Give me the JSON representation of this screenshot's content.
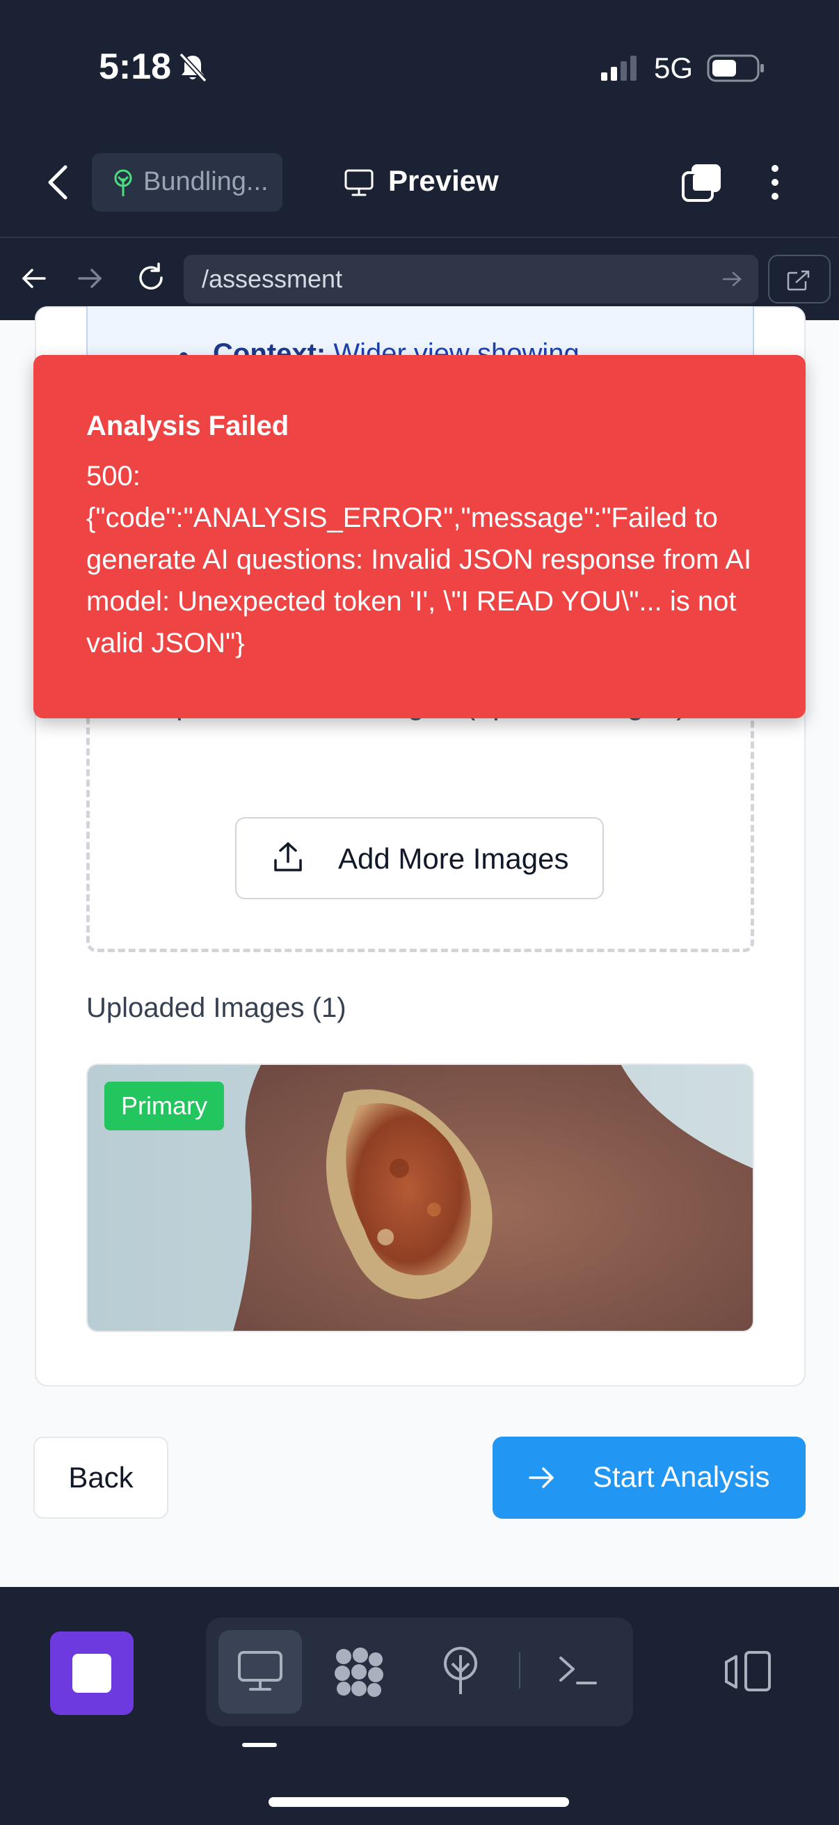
{
  "status_bar": {
    "time": "5:18",
    "network": "5G"
  },
  "app_bar": {
    "bundling_label": "Bundling...",
    "preview_label": "Preview"
  },
  "url_bar": {
    "url": "/assessment"
  },
  "tips": {
    "term": "Context:",
    "text": "Wider view showing"
  },
  "upload": {
    "hint": "Upload wound images (up to 5 images)",
    "add_more_label": "Add More Images",
    "uploaded_heading": "Uploaded Images (1)",
    "primary_badge": "Primary"
  },
  "actions": {
    "back_label": "Back",
    "start_label": "Start Analysis"
  },
  "error_toast": {
    "title": "Analysis Failed",
    "message": "500:\n{\"code\":\"ANALYSIS_ERROR\",\"message\":\"Failed to generate AI questions: Invalid JSON response from AI model: Unexpected token 'I', \\\"I READ YOU\\\"... is not valid JSON\"}"
  },
  "colors": {
    "error_red": "#ef4444",
    "primary_blue": "#2196f3",
    "badge_green": "#22c55e",
    "stop_purple": "#6d3ae0",
    "chrome_bg": "#1b2233"
  },
  "icons": [
    "bell-slash-icon",
    "signal-icon",
    "battery-icon",
    "chevron-left-icon",
    "tree-icon",
    "monitor-icon",
    "tabs-icon",
    "more-vertical-icon",
    "arrow-left-icon",
    "arrow-right-icon",
    "reload-icon",
    "external-link-icon",
    "upload-icon",
    "terminal-icon",
    "panel-toggle-icon"
  ]
}
